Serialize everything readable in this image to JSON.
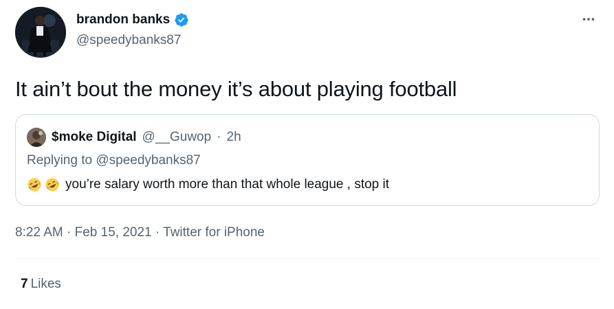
{
  "author": {
    "name": "brandon banks",
    "handle": "@speedybanks87",
    "verified": true
  },
  "tweet": {
    "text": "It ain’t bout the money it’s about playing football"
  },
  "quoted": {
    "name": "$moke Digital",
    "handle": "@__Guwop",
    "separator": "·",
    "time": "2h",
    "replying_prefix": "Replying to",
    "replying_handle": "@speedybanks87",
    "emojis": [
      "rolling-on-floor-laughing",
      "rolling-on-floor-laughing"
    ],
    "text": "you’re salary worth more than that whole league , stop it"
  },
  "meta": {
    "time": "8:22 AM",
    "separator1": "·",
    "date": "Feb 15, 2021",
    "separator2": "·",
    "source": "Twitter for iPhone"
  },
  "stats": {
    "likes_count": "7",
    "likes_label": "Likes"
  },
  "colors": {
    "text": "#0f1419",
    "secondary": "#536471",
    "verified": "#1d9bf0",
    "border": "#cfd9de"
  },
  "icons": {
    "more": "more-horizontal-icon",
    "verified": "verified-badge-icon"
  }
}
